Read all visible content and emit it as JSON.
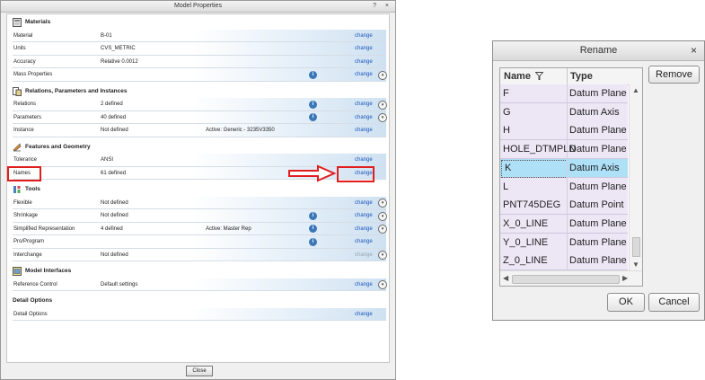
{
  "model_properties": {
    "title": "Model Properties",
    "window_buttons": "? ×",
    "sections": [
      {
        "title": "Materials",
        "icon": "materials-icon",
        "rows": [
          {
            "label": "Material",
            "value": "B-01",
            "active": "",
            "info": false,
            "change": "change",
            "expand": false,
            "disabled": false
          },
          {
            "label": "Units",
            "value": "CVS_METRIC",
            "active": "",
            "info": false,
            "change": "change",
            "expand": false,
            "disabled": false
          },
          {
            "label": "Accuracy",
            "value": "Relative 0.0012",
            "active": "",
            "info": false,
            "change": "change",
            "expand": false,
            "disabled": false
          },
          {
            "label": "Mass Properties",
            "value": "",
            "active": "",
            "info": true,
            "change": "change",
            "expand": true,
            "disabled": false
          }
        ]
      },
      {
        "title": "Relations, Parameters and Instances",
        "icon": "relations-icon",
        "rows": [
          {
            "label": "Relations",
            "value": "2 defined",
            "active": "",
            "info": true,
            "change": "change",
            "expand": true,
            "disabled": false
          },
          {
            "label": "Parameters",
            "value": "40 defined",
            "active": "",
            "info": true,
            "change": "change",
            "expand": true,
            "disabled": false
          },
          {
            "label": "Instance",
            "value": "Not defined",
            "active": "Active: Generic - 3235V3350",
            "info": false,
            "change": "change",
            "expand": false,
            "disabled": false
          }
        ]
      },
      {
        "title": "Features and Geometry",
        "icon": "features-icon",
        "rows": [
          {
            "label": "Tolerance",
            "value": "ANSI",
            "active": "",
            "info": false,
            "change": "change",
            "expand": false,
            "disabled": false
          },
          {
            "label": "Names",
            "value": "61 defined",
            "active": "",
            "info": false,
            "change": "change",
            "expand": false,
            "disabled": false
          }
        ]
      },
      {
        "title": "Tools",
        "icon": "tools-icon",
        "rows": [
          {
            "label": "Flexible",
            "value": "Not defined",
            "active": "",
            "info": false,
            "change": "change",
            "expand": true,
            "disabled": false
          },
          {
            "label": "Shrinkage",
            "value": "Not defined",
            "active": "",
            "info": true,
            "change": "change",
            "expand": true,
            "disabled": false
          },
          {
            "label": "Simplified Representation",
            "value": "4 defined",
            "active": "Active: Master Rep",
            "info": true,
            "change": "change",
            "expand": true,
            "disabled": false
          },
          {
            "label": "Pro/Program",
            "value": "",
            "active": "",
            "info": true,
            "change": "change",
            "expand": false,
            "disabled": false
          },
          {
            "label": "Interchange",
            "value": "Not defined",
            "active": "",
            "info": false,
            "change": "change",
            "expand": true,
            "disabled": true
          }
        ]
      },
      {
        "title": "Model Interfaces",
        "icon": "interfaces-icon",
        "rows": [
          {
            "label": "Reference Control",
            "value": "Default settings",
            "active": "",
            "info": false,
            "change": "change",
            "expand": true,
            "disabled": false
          }
        ]
      },
      {
        "title": "Detail Options",
        "icon": "",
        "rows": [
          {
            "label": "Detail Options",
            "value": "",
            "active": "",
            "info": false,
            "change": "change",
            "expand": false,
            "disabled": false
          }
        ]
      }
    ],
    "close_label": "Close"
  },
  "rename": {
    "title": "Rename",
    "close_glyph": "×",
    "columns": {
      "name": "Name",
      "type": "Type"
    },
    "rows": [
      {
        "name": "F",
        "type": "Datum Plane",
        "selected": false
      },
      {
        "name": "G",
        "type": "Datum Axis",
        "selected": false
      },
      {
        "name": "H",
        "type": "Datum Plane",
        "selected": false
      },
      {
        "name": "HOLE_DTMPLN",
        "type": "Datum Plane",
        "selected": false
      },
      {
        "name": "K",
        "type": "Datum Axis",
        "selected": true
      },
      {
        "name": "L",
        "type": "Datum Plane",
        "selected": false
      },
      {
        "name": "PNT745DEG",
        "type": "Datum Point",
        "selected": false
      },
      {
        "name": "X_0_LINE",
        "type": "Datum Plane",
        "selected": false
      },
      {
        "name": "Y_0_LINE",
        "type": "Datum Plane",
        "selected": false
      },
      {
        "name": "Z_0_LINE",
        "type": "Datum Plane",
        "selected": false
      }
    ],
    "remove_label": "Remove",
    "ok_label": "OK",
    "cancel_label": "Cancel"
  },
  "colors": {
    "highlight": "#e01e1e",
    "link": "#1a54b8",
    "selected_row": "#aee0f8",
    "row_bg": "#ece6f5"
  }
}
